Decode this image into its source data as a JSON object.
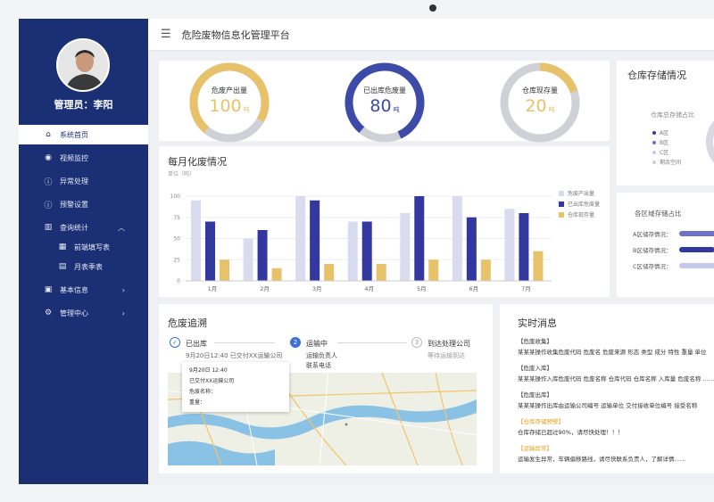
{
  "header": {
    "title": "危险废物信息化管理平台"
  },
  "user": {
    "label": "管理员：李阳"
  },
  "sidebar": {
    "items": [
      {
        "label": "系统首页",
        "icon": "home-icon"
      },
      {
        "label": "视频监控",
        "icon": "camera-icon"
      },
      {
        "label": "异常处理",
        "icon": "alert-icon"
      },
      {
        "label": "预警设置",
        "icon": "alert-icon"
      },
      {
        "label": "查询统计",
        "icon": "chart-icon"
      },
      {
        "label": "前端填写表",
        "icon": "form-icon"
      },
      {
        "label": "月表季表",
        "icon": "table-icon"
      },
      {
        "label": "基本信息",
        "icon": "info-icon"
      },
      {
        "label": "管理中心",
        "icon": "gear-icon"
      }
    ]
  },
  "gauges": [
    {
      "label": "危废产出量",
      "value": "100",
      "unit": "吨",
      "fraction": 0.72,
      "color": "#e8c26a"
    },
    {
      "label": "已出库危废量",
      "value": "80",
      "unit": "吨",
      "fraction": 0.82,
      "color": "#3d4aa8"
    },
    {
      "label": "仓库现存量",
      "value": "20",
      "unit": "吨",
      "fraction": 0.2,
      "color": "#e8c26a"
    }
  ],
  "warehouse": {
    "title": "仓库存储情况",
    "total_label": "仓库总存储占比",
    "legend": [
      "A区",
      "B区",
      "C区",
      "剩余空间"
    ],
    "zone_title": "各区域存储占比",
    "zones": [
      {
        "label": "A区储存情况：",
        "fraction": 0.55
      },
      {
        "label": "B区储存情况：",
        "fraction": 0.5
      },
      {
        "label": "C区储存情况：",
        "fraction": 0.6
      }
    ]
  },
  "chart_data": {
    "type": "bar",
    "title": "每月化废情况",
    "unit": "单位（吨）",
    "categories": [
      "1月",
      "2月",
      "3月",
      "4月",
      "5月",
      "6月",
      "7月"
    ],
    "yticks": [
      "0",
      "25",
      "50",
      "75",
      "100"
    ],
    "ylim": [
      0,
      100
    ],
    "series": [
      {
        "name": "危废产出量",
        "color": "#d8dcee",
        "values": [
          95,
          50,
          100,
          70,
          80,
          100,
          85
        ]
      },
      {
        "name": "已出库危废量",
        "color": "#3238a0",
        "values": [
          70,
          60,
          95,
          70,
          100,
          75,
          80
        ]
      },
      {
        "name": "仓库现存量",
        "color": "#e8c26a",
        "values": [
          25,
          15,
          20,
          20,
          25,
          25,
          35
        ]
      }
    ],
    "legend": "right"
  },
  "trace": {
    "title": "危废追溯",
    "steps": [
      {
        "num": "✓",
        "label": "已出库",
        "detail1": "9月20日12:40 已交付XX运输公司",
        "detail2": "危"
      },
      {
        "num": "2",
        "label": "运输中",
        "detail1": "运输负责人",
        "detail2": "联系电话"
      },
      {
        "num": "3",
        "label": "到达处理公司",
        "detail1": "等待运输到达",
        "detail2": ""
      }
    ],
    "popup": [
      "9月20日 12:40",
      "已交付XX运输公司",
      "危废名称：",
      "重量："
    ]
  },
  "messages": {
    "title": "实时消息",
    "items": [
      {
        "head": "【危废收集】",
        "body": "某某某操作收集危废代码 危废名 危废来源 形态  类型  成分  特性  重量 单位",
        "warn": false
      },
      {
        "head": "【危废入库】",
        "body": "某某某操作入库危废代码 危废名称 仓库代码 仓库名称 入库量 危废名称 ……",
        "warn": false
      },
      {
        "head": "【危废出库】",
        "body": "某某某操作出库由运输公司编号 运输单位 交付接收单位编号 接受名称",
        "warn": false
      },
      {
        "head": "【仓库存储预警】",
        "body": "仓库存储已超过90%，请尽快处理！！！",
        "warn": true
      },
      {
        "head": "【运输异常】",
        "body": "运输发生异常，车辆偏移路线，请尽快联系负责人，了解详情……",
        "warn": true
      }
    ]
  }
}
